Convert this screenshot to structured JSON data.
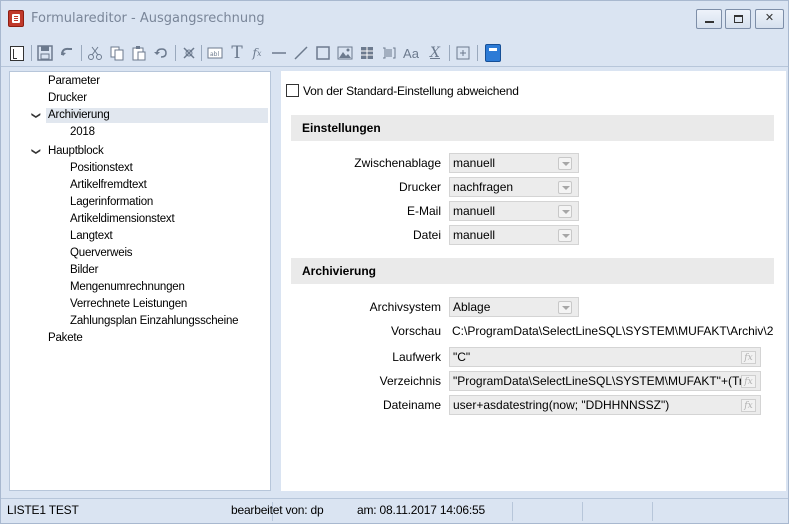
{
  "window": {
    "title": "Formulareditor - Ausgangsrechnung"
  },
  "toolbar": {
    "icons": [
      "tree-toggle-icon",
      "save-icon",
      "undo-icon",
      "cut-icon",
      "copy-icon",
      "paste-icon",
      "undo-arrow-icon",
      "stamp-icon",
      "textfield-icon",
      "text-icon",
      "formula-icon",
      "horizontal-line-icon",
      "diagonal-line-icon",
      "rectangle-icon",
      "image-icon",
      "table-icon",
      "barcode-icon",
      "font-icon",
      "format-icon",
      "special-icon",
      "blue-info-icon"
    ]
  },
  "tree": {
    "items": [
      {
        "label": "Parameter",
        "level": 0,
        "expandable": false
      },
      {
        "label": "Drucker",
        "level": 0,
        "expandable": false
      },
      {
        "label": "Archivierung",
        "level": 0,
        "expandable": true,
        "selected": true
      },
      {
        "label": "2018",
        "level": 1,
        "expandable": false
      },
      {
        "label": "Hauptblock",
        "level": 0,
        "expandable": true
      },
      {
        "label": "Positionstext",
        "level": 1,
        "expandable": false
      },
      {
        "label": "Artikelfremdtext",
        "level": 1,
        "expandable": false
      },
      {
        "label": "Lagerinformation",
        "level": 1,
        "expandable": false
      },
      {
        "label": "Artikeldimensionstext",
        "level": 1,
        "expandable": false
      },
      {
        "label": "Langtext",
        "level": 1,
        "expandable": false
      },
      {
        "label": "Querverweis",
        "level": 1,
        "expandable": false
      },
      {
        "label": "Bilder",
        "level": 1,
        "expandable": false
      },
      {
        "label": "Mengenumrechnungen",
        "level": 1,
        "expandable": false
      },
      {
        "label": "Verrechnete Leistungen",
        "level": 1,
        "expandable": false
      },
      {
        "label": "Zahlungsplan Einzahlungsscheine",
        "level": 1,
        "expandable": false
      },
      {
        "label": "Pakete",
        "level": 0,
        "expandable": false
      }
    ]
  },
  "main": {
    "override_checkbox": {
      "label": "Von der Standard-Einstellung abweichend",
      "checked": false
    },
    "settings": {
      "header": "Einstellungen",
      "rows": [
        {
          "label": "Zwischenablage",
          "value": "manuell"
        },
        {
          "label": "Drucker",
          "value": "nachfragen"
        },
        {
          "label": "E-Mail",
          "value": "manuell"
        },
        {
          "label": "Datei",
          "value": "manuell"
        }
      ]
    },
    "archiving": {
      "header": "Archivierung",
      "archivsystem": {
        "label": "Archivsystem",
        "value": "Ablage"
      },
      "vorschau": {
        "label": "Vorschau",
        "value": "C:\\ProgramData\\SelectLineSQL\\SYSTEM\\MUFAKT\\Archiv\\2"
      },
      "laufwerk": {
        "label": "Laufwerk",
        "value": "\"C\""
      },
      "verzeichnis": {
        "label": "Verzeichnis",
        "value": "\"ProgramData\\SelectLineSQL\\SYSTEM\\MUFAKT\"+(Tre"
      },
      "dateiname": {
        "label": "Dateiname",
        "value": "user+asdatestring(now; \"DDHHNNSSZ\")"
      }
    }
  },
  "statusbar": {
    "list": "LISTE1 TEST",
    "edited_by": "bearbeitet von: dp",
    "date": "am: 08.11.2017 14:06:55"
  }
}
